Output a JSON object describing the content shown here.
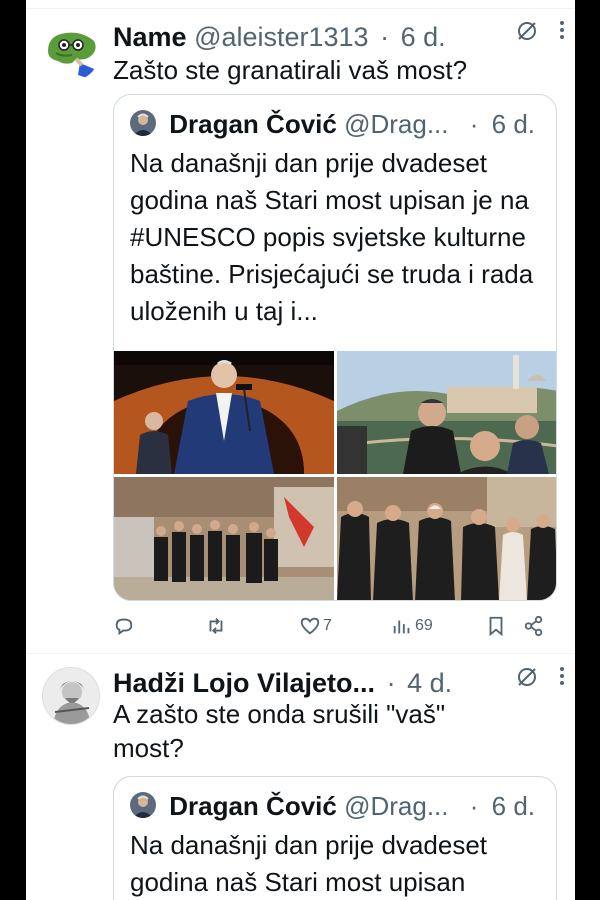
{
  "tweets": [
    {
      "name": "Name",
      "handle": "@aleister1313",
      "dot": "·",
      "time": "6 d.",
      "text": "Zašto ste granatirali vaš most?",
      "quote": {
        "name": "Dragan Čović",
        "handle": "@Drag...",
        "dot": "·",
        "time": "6 d.",
        "text": "Na današnji dan prije dvadeset godina naš Stari most upisan je na #UNESCO popis svjetske kulturne baštine. Prisjećajući se truda i rada uloženih u taj i..."
      },
      "actions": {
        "reply_count": "",
        "retweet_count": "",
        "like_count": "7",
        "views_count": "69"
      }
    },
    {
      "name": "Hadži Lojo Vilajeto...",
      "dot": "·",
      "time": "4 d.",
      "text": "A zašto ste onda srušili \"vaš\" most?",
      "quote": {
        "name": "Dragan Čović",
        "handle": "@Drag...",
        "dot": "·",
        "time": "6 d.",
        "text": "Na današnji dan prije dvadeset godina naš Stari most upisan"
      }
    }
  ],
  "icons": {
    "grok": "grok-slash-icon",
    "more": "more-vertical-icon",
    "reply": "reply-icon",
    "retweet": "retweet-icon",
    "like": "heart-icon",
    "views": "views-bar-icon",
    "bookmark": "bookmark-icon",
    "share": "share-icon"
  },
  "colors": {
    "text": "#0f1419",
    "secondary": "#536471",
    "border": "#cfd9de",
    "background": "#ffffff"
  }
}
